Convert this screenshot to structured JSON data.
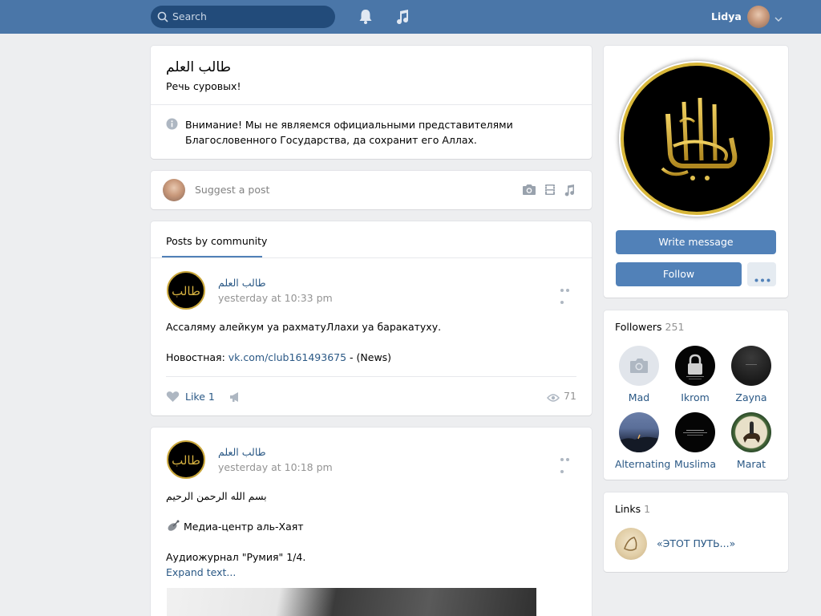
{
  "topbar": {
    "search_placeholder": "Search",
    "bell_icon": "bell-icon",
    "music_icon": "music-note-icon",
    "user_name": "Lidya",
    "accent": "#4a76a8"
  },
  "header": {
    "title": "طالب العلم",
    "status": "Речь суровых!",
    "info": "Внимание! Мы не являемся официальными представителями Благословенного Государства, да сохранит его Аллах."
  },
  "suggest": {
    "placeholder": "Suggest a post"
  },
  "posts_tab": {
    "label": "Posts by community"
  },
  "posts": [
    {
      "author": "طالب العلم",
      "date": "yesterday at 10:33 pm",
      "line1": "Ассаляму алейкум уа рахматуЛлахи уа баракатуху.",
      "line2_prefix": "Новостная: ",
      "line2_link": "vk.com/club161493675",
      "line2_suffix": " - (News)",
      "like_label": "Like",
      "like_count": "1",
      "views": "71"
    },
    {
      "author": "طالب العلم",
      "date": "yesterday at 10:18 pm",
      "line1": "بسم الله الرحمن الرحيم",
      "line2": "Медиа-центр аль-Хаят",
      "line3": "Аудиожурнал \"Румия\" 1/4.",
      "expand": "Expand text..."
    }
  ],
  "sidebar": {
    "write_message": "Write message",
    "follow": "Follow",
    "followers_label": "Followers",
    "followers_count": "251",
    "followers": [
      {
        "name": "Mad"
      },
      {
        "name": "Ikrom"
      },
      {
        "name": "Zayna"
      },
      {
        "name": "Alternating"
      },
      {
        "name": "Muslima"
      },
      {
        "name": "Marat"
      }
    ],
    "links_label": "Links",
    "links_count": "1",
    "link_title": "«ЭТОТ ПУТЬ...»"
  }
}
